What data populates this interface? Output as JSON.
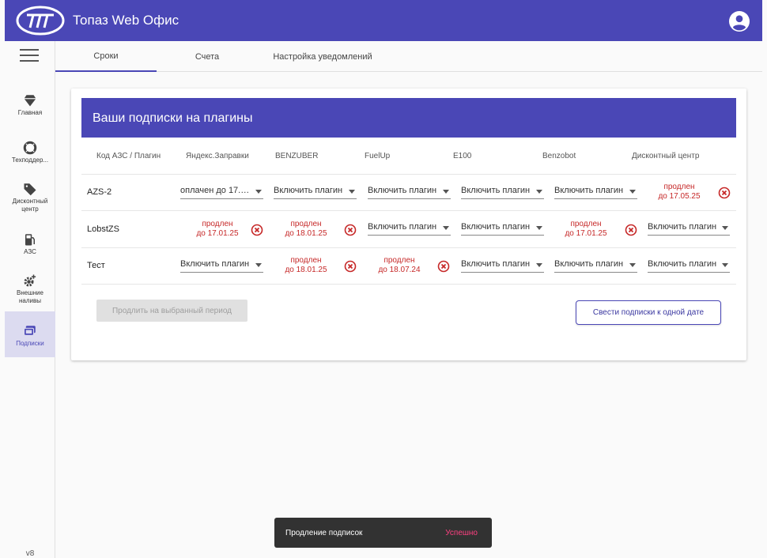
{
  "app": {
    "title": "Топаз Web Офис"
  },
  "nav": {
    "items": [
      {
        "label": "Главная",
        "icon": "diamond-icon"
      },
      {
        "label": "Техподдер...",
        "icon": "lifebuoy-icon"
      },
      {
        "label": "Дисконтный центр",
        "icon": "tag-icon"
      },
      {
        "label": "АЗС",
        "icon": "fuel-pump-icon"
      },
      {
        "label": "Внешние наливы",
        "icon": "gear-plus-icon"
      },
      {
        "label": "Подписки",
        "icon": "subscriptions-icon"
      }
    ],
    "active": "Подписки",
    "version": "v8"
  },
  "tabs": [
    "Сроки",
    "Счета",
    "Настройка уведомлений"
  ],
  "active_tab": "Сроки",
  "card": {
    "title": "Ваши подписки на плагины",
    "columns": [
      "Код АЗС / Плагин",
      "Яндекс.Заправки",
      "BENZUBER",
      "FuelUp",
      "E100",
      "Benzobot",
      "Дисконтный центр"
    ],
    "rows": [
      {
        "name": "AZS-2",
        "cells": [
          {
            "type": "select",
            "text": "оплачен до 17.1..."
          },
          {
            "type": "select",
            "text": "Включить плагин"
          },
          {
            "type": "select",
            "text": "Включить плагин"
          },
          {
            "type": "select",
            "text": "Включить плагин"
          },
          {
            "type": "select",
            "text": "Включить плагин"
          },
          {
            "type": "renewed",
            "line1": "продлен",
            "line2": "до 17.05.25"
          }
        ]
      },
      {
        "name": "LobstZS",
        "cells": [
          {
            "type": "renewed",
            "line1": "продлен",
            "line2": "до 17.01.25"
          },
          {
            "type": "renewed",
            "line1": "продлен",
            "line2": "до 18.01.25"
          },
          {
            "type": "select",
            "text": "Включить плагин"
          },
          {
            "type": "select",
            "text": "Включить плагин"
          },
          {
            "type": "renewed",
            "line1": "продлен",
            "line2": "до 17.01.25"
          },
          {
            "type": "select",
            "text": "Включить плагин"
          }
        ]
      },
      {
        "name": "Тест",
        "cells": [
          {
            "type": "select",
            "text": "Включить плагин"
          },
          {
            "type": "renewed",
            "line1": "продлен",
            "line2": "до 18.01.25"
          },
          {
            "type": "renewed",
            "line1": "продлен",
            "line2": "до 18.07.24"
          },
          {
            "type": "select",
            "text": "Включить плагин"
          },
          {
            "type": "select",
            "text": "Включить плагин"
          },
          {
            "type": "select",
            "text": "Включить плагин"
          }
        ]
      }
    ],
    "extend_button": "Продлить на выбранный период",
    "align_button": "Свести подписки к одной дате"
  },
  "snackbar": {
    "message": "Продление подписок",
    "action": "Успешно"
  },
  "colors": {
    "primary": "#4a47b6",
    "renewed_text": "#c62828",
    "snackbar_action": "#ff4081"
  }
}
